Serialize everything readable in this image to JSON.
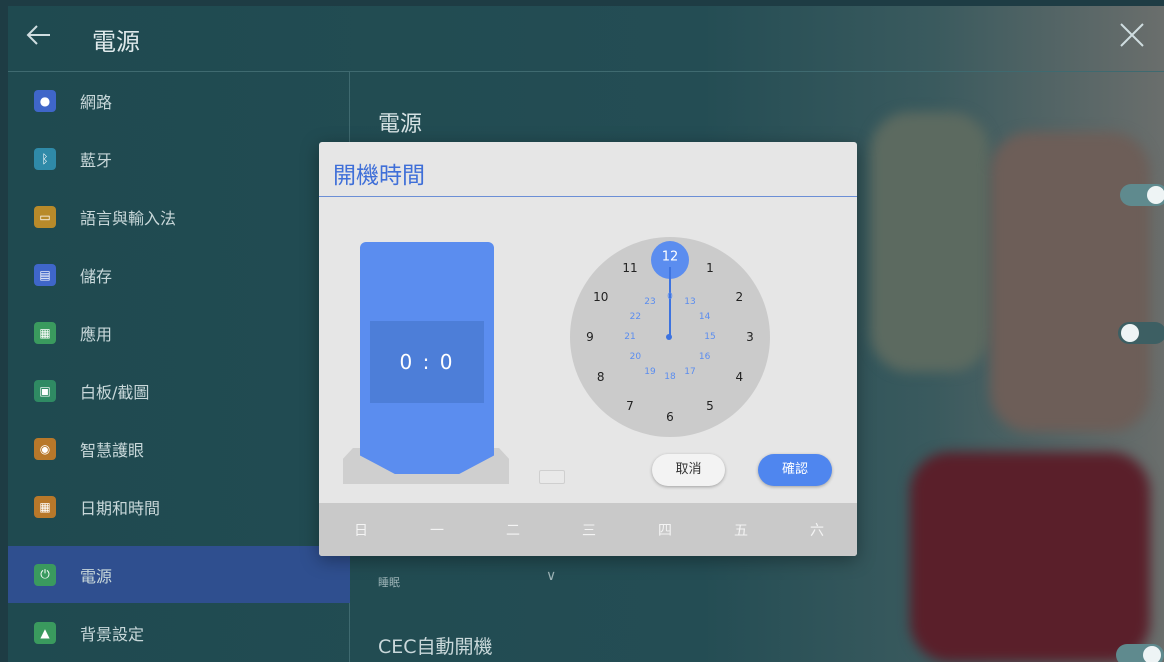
{
  "topbar": {
    "title": "電源",
    "back_icon": "arrow-left-icon",
    "close_icon": "close-icon"
  },
  "sidebar": {
    "items": [
      {
        "label": "網路",
        "icon": "globe-icon",
        "color": "#3f66c9"
      },
      {
        "label": "藍牙",
        "icon": "bluetooth-icon",
        "color": "#2f8aa8"
      },
      {
        "label": "語言與輸入法",
        "icon": "keyboard-icon",
        "color": "#b88a2a"
      },
      {
        "label": "儲存",
        "icon": "storage-icon",
        "color": "#3f66c9"
      },
      {
        "label": "應用",
        "icon": "apps-icon",
        "color": "#3a9a5e"
      },
      {
        "label": "白板/截圖",
        "icon": "whiteboard-icon",
        "color": "#2f8a63"
      },
      {
        "label": "智慧護眼",
        "icon": "eye-icon",
        "color": "#b8782a"
      },
      {
        "label": "日期和時間",
        "icon": "calendar-icon",
        "color": "#b8782a"
      },
      {
        "label": "電源",
        "icon": "power-icon",
        "color": "#3a9a5e",
        "active": true
      },
      {
        "label": "背景設定",
        "icon": "image-icon",
        "color": "#3a9a5e"
      }
    ]
  },
  "content": {
    "title": "電源",
    "sleep_value": "睡眠",
    "cec_label": "CEC自動開機",
    "toggles": [
      {
        "on": true
      },
      {
        "on": false
      },
      {
        "on": true
      }
    ]
  },
  "dialog": {
    "title": "開機時間",
    "time_display": "0 : 0",
    "selected_hour": "12",
    "clock_outer": [
      "12",
      "1",
      "2",
      "3",
      "4",
      "5",
      "6",
      "7",
      "8",
      "9",
      "10",
      "11"
    ],
    "clock_inner": [
      "0",
      "13",
      "14",
      "15",
      "16",
      "17",
      "18",
      "19",
      "20",
      "21",
      "22",
      "23"
    ],
    "cancel_label": "取消",
    "confirm_label": "確認",
    "days": [
      "日",
      "一",
      "二",
      "三",
      "四",
      "五",
      "六"
    ],
    "accent_color": "#5b8def"
  }
}
